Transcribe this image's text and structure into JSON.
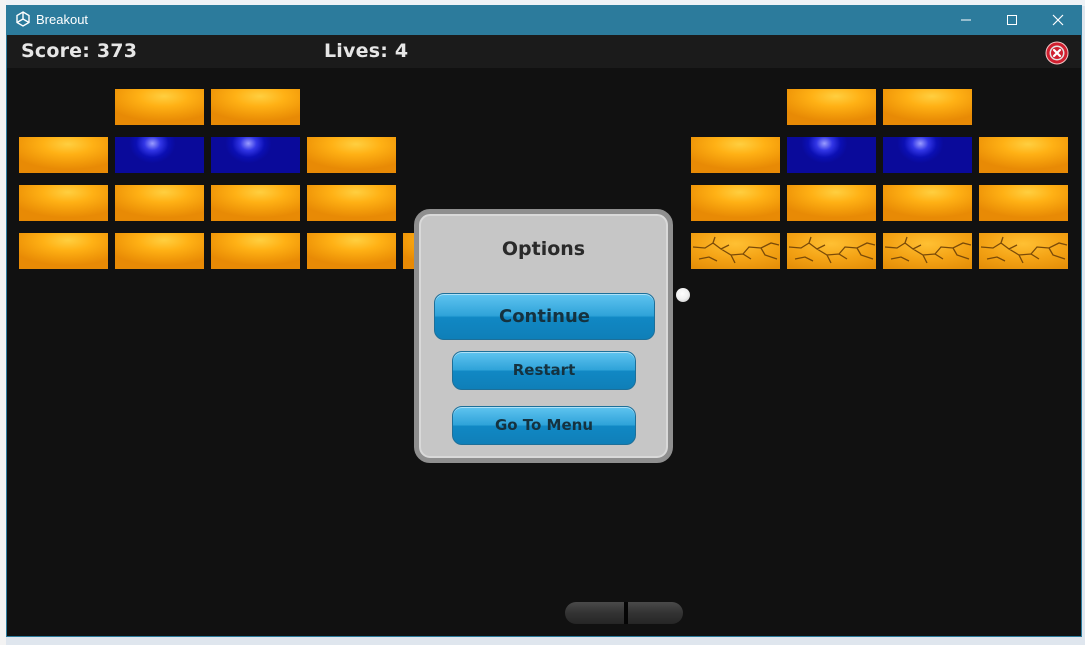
{
  "window": {
    "title": "Breakout",
    "minimize_icon": "minimize-icon",
    "maximize_icon": "maximize-icon",
    "close_icon": "close-icon",
    "titlebar_color": "#2c7b9c"
  },
  "hud": {
    "score_text": "Score: 373",
    "lives_text": "Lives: 4",
    "close_icon": "close-circle-icon",
    "close_color": "#d01f2f"
  },
  "bricks": {
    "colors": {
      "orange": "#f7a10f",
      "blue": "#0b0fb3"
    },
    "left_rows": [
      [
        "empty",
        "orange",
        "orange",
        "empty"
      ],
      [
        "orange",
        "blue",
        "blue",
        "orange"
      ],
      [
        "orange",
        "orange",
        "orange",
        "orange"
      ],
      [
        "orange",
        "orange",
        "orange",
        "orange",
        "orange"
      ]
    ],
    "right_rows": [
      [
        "empty",
        "orange",
        "orange",
        "empty"
      ],
      [
        "orange",
        "blue",
        "blue",
        "orange"
      ],
      [
        "orange",
        "orange",
        "orange",
        "orange"
      ],
      [
        "cracked",
        "cracked",
        "cracked",
        "cracked"
      ]
    ]
  },
  "dialog": {
    "title": "Options",
    "buttons": {
      "continue": "Continue",
      "restart": "Restart",
      "menu": "Go To Menu"
    },
    "button_color": "#1a8ccc"
  }
}
